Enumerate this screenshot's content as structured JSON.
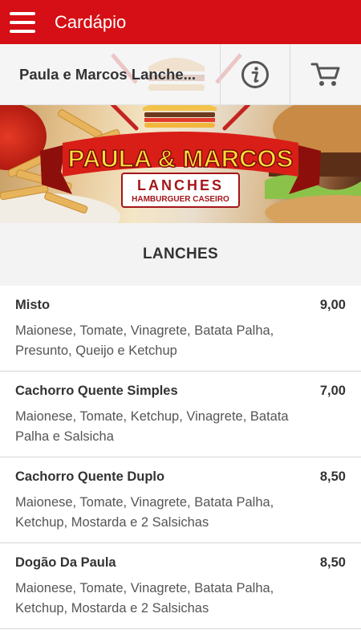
{
  "appbar": {
    "title": "Cardápio",
    "menu_icon": "hamburger-menu-icon"
  },
  "store": {
    "name": "Paula e Marcos Lanche...",
    "info_icon": "info-icon",
    "cart_icon": "cart-icon"
  },
  "banner": {
    "logo_main": "PAULA & MARCOS",
    "logo_sub": "LANCHES",
    "logo_tagline": "HAMBURGUER CASEIRO",
    "colors": {
      "ribbon": "#d91e18",
      "ribbon_dark": "#8c0f0c",
      "logo_text": "#ffe23a",
      "lanches_text": "#a4161a"
    }
  },
  "section": {
    "title": "LANCHES"
  },
  "menu": {
    "items": [
      {
        "name": "Misto",
        "price": "9,00",
        "description": "Maionese, Tomate, Vinagrete, Batata Palha, Presunto, Queijo e Ketchup"
      },
      {
        "name": "Cachorro Quente Simples",
        "price": "7,00",
        "description": "Maionese, Tomate, Ketchup, Vinagrete, Batata Palha e Salsicha"
      },
      {
        "name": "Cachorro Quente Duplo",
        "price": "8,50",
        "description": "Maionese, Tomate, Vinagrete, Batata Palha, Ketchup, Mostarda e 2 Salsichas"
      },
      {
        "name": "Dogão Da Paula",
        "price": "8,50",
        "description": "Maionese, Tomate, Vinagrete, Batata Palha, Ketchup, Mostarda e 2 Salsichas"
      }
    ]
  },
  "colors": {
    "brand": "#d50f15",
    "section_bg": "#f3f3f3",
    "divider": "#d6d6d6"
  }
}
